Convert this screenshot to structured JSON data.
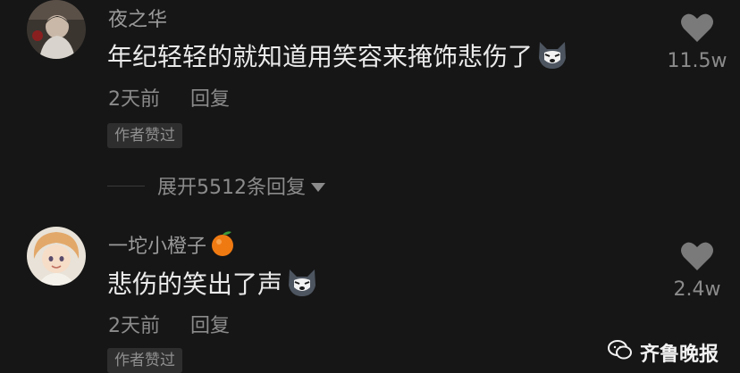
{
  "comments": [
    {
      "username": "夜之华",
      "content": "年纪轻轻的就知道用笑容来掩饰悲伤了",
      "emoji": "wolf-emoji",
      "time": "2天前",
      "reply_label": "回复",
      "liked_badge": "作者赞过",
      "like_count": "11.5w",
      "like_icon": "heart-icon"
    },
    {
      "username": "一坨小橙子",
      "username_emoji": "orange-emoji",
      "content": "悲伤的笑出了声",
      "emoji": "wolf-emoji",
      "time": "2天前",
      "reply_label": "回复",
      "liked_badge": "作者赞过",
      "like_count": "2.4w",
      "like_icon": "heart-icon"
    }
  ],
  "expand_replies": {
    "label": "展开5512条回复",
    "icon": "caret-down-icon"
  },
  "watermark": {
    "text": "齐鲁晚报",
    "icon": "wechat-icon"
  },
  "colors": {
    "background": "#161616",
    "primary_text": "#eaeaea",
    "secondary_text": "#8b8b8b",
    "badge_bg": "#2e2e2e"
  }
}
